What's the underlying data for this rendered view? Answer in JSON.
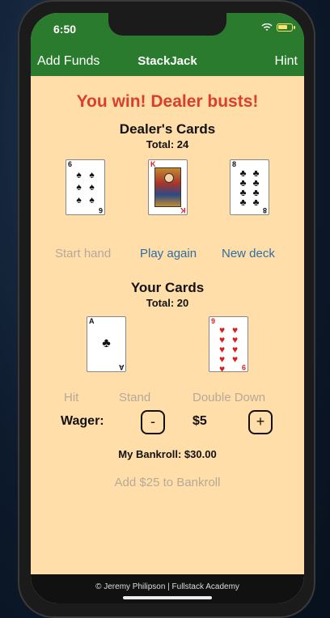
{
  "status_bar": {
    "time": "6:50"
  },
  "nav": {
    "left": "Add Funds",
    "title": "StackJack",
    "right": "Hint"
  },
  "result_message": "You win! Dealer busts!",
  "dealer": {
    "title": "Dealer's Cards",
    "total": "Total: 24",
    "cards": [
      {
        "rank": "6",
        "suit": "♠",
        "color": "black"
      },
      {
        "rank": "K",
        "suit": "♥",
        "color": "red"
      },
      {
        "rank": "8",
        "suit": "♣",
        "color": "black"
      }
    ]
  },
  "hand_buttons": {
    "start": "Start hand",
    "play_again": "Play again",
    "new_deck": "New deck"
  },
  "player": {
    "title": "Your Cards",
    "total": "Total: 20",
    "cards": [
      {
        "rank": "A",
        "suit": "♣",
        "color": "black"
      },
      {
        "rank": "9",
        "suit": "♥",
        "color": "red"
      }
    ]
  },
  "action_buttons": {
    "hit": "Hit",
    "stand": "Stand",
    "double_down": "Double Down"
  },
  "wager": {
    "label": "Wager:",
    "minus": "-",
    "value": "$5",
    "plus": "+"
  },
  "bankroll": "My Bankroll: $30.00",
  "add_funds_button": "Add $25 to Bankroll",
  "footer": "© Jeremy Philipson | Fullstack Academy",
  "colors": {
    "nav": "#2a7b2d",
    "background": "#ffdea9",
    "result": "#d93f2a",
    "link": "#2f6da3",
    "disabled": "#b6a99a"
  }
}
